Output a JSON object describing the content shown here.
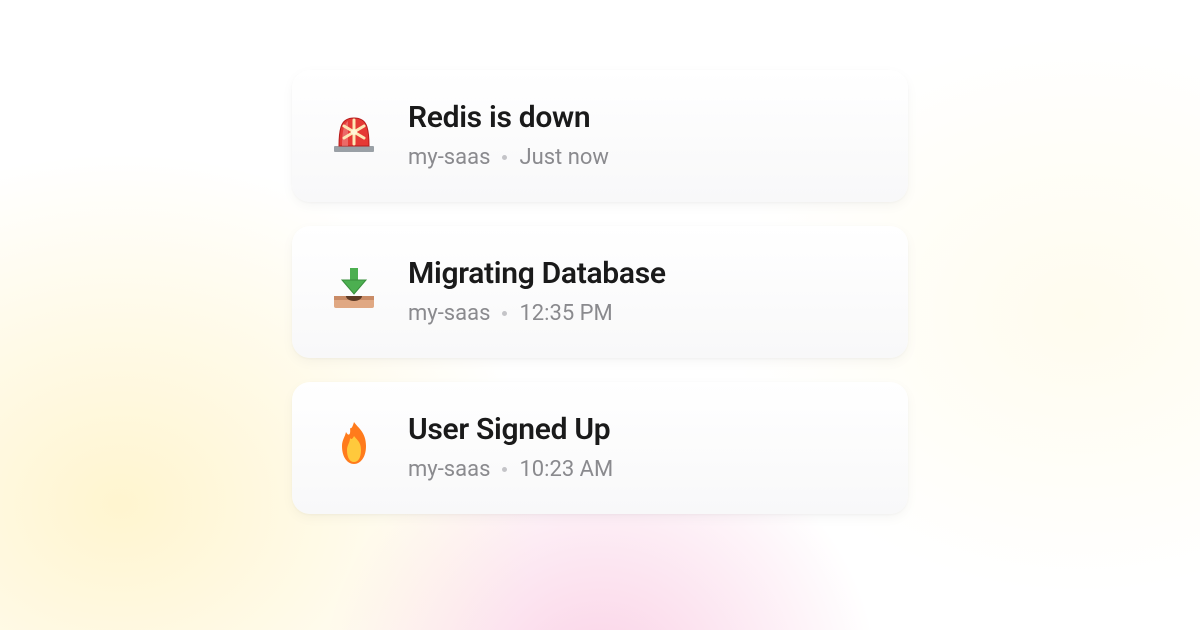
{
  "notifications": [
    {
      "icon": "siren-icon",
      "title": "Redis is down",
      "project": "my-saas",
      "time": "Just now"
    },
    {
      "icon": "download-tray-icon",
      "title": "Migrating Database",
      "project": "my-saas",
      "time": "12:35 PM"
    },
    {
      "icon": "fire-icon",
      "title": "User Signed Up",
      "project": "my-saas",
      "time": "10:23 AM"
    }
  ]
}
